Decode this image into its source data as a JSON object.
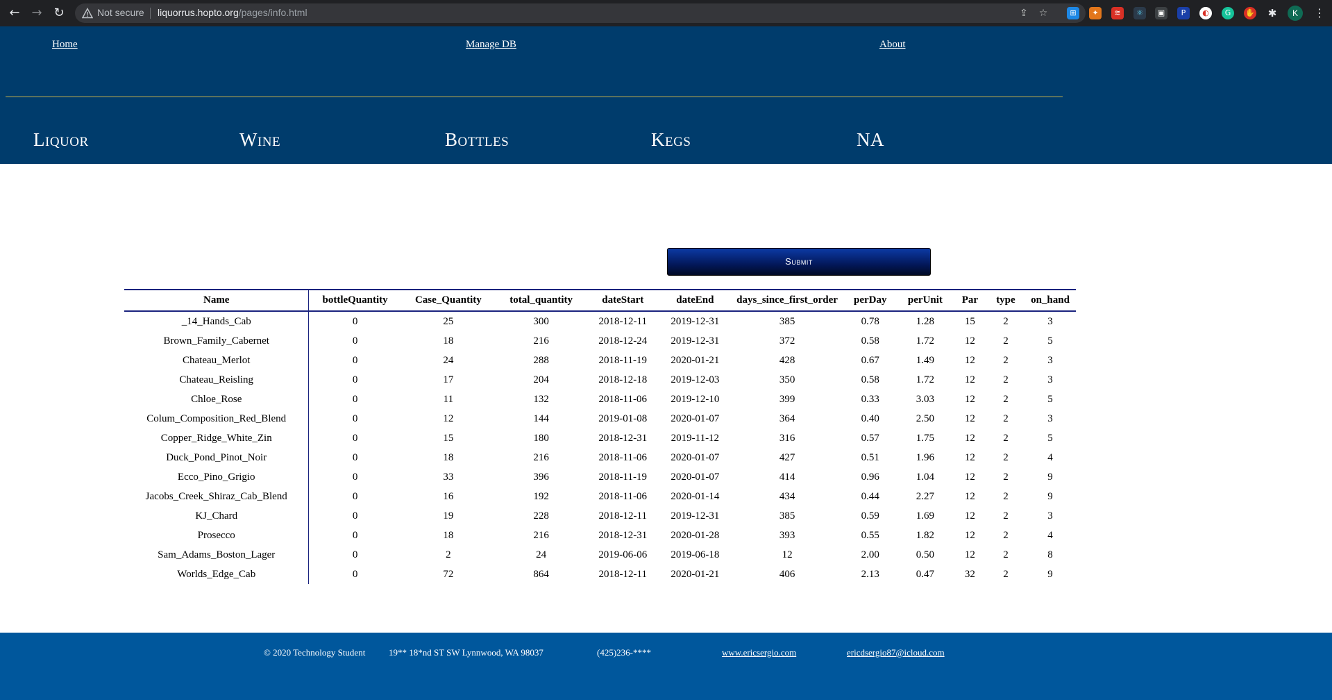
{
  "browser": {
    "not_secure": "Not secure",
    "url_host": "liquorrus.hopto.org",
    "url_path": "/pages/info.html",
    "profile_initial": "K"
  },
  "nav": {
    "home": "Home",
    "manage_db": "Manage DB",
    "about": "About"
  },
  "categories": [
    "Liquor",
    "Wine",
    "Bottles",
    "Kegs",
    "NA"
  ],
  "submit_label": "Submit",
  "table": {
    "headers": [
      "Name",
      "bottleQuantity",
      "Case_Quantity",
      "total_quantity",
      "dateStart",
      "dateEnd",
      "days_since_first_order",
      "perDay",
      "perUnit",
      "Par",
      "type",
      "on_hand"
    ],
    "rows": [
      [
        "_14_Hands_Cab",
        "0",
        "25",
        "300",
        "2018-12-11",
        "2019-12-31",
        "385",
        "0.78",
        "1.28",
        "15",
        "2",
        "3"
      ],
      [
        "Brown_Family_Cabernet",
        "0",
        "18",
        "216",
        "2018-12-24",
        "2019-12-31",
        "372",
        "0.58",
        "1.72",
        "12",
        "2",
        "5"
      ],
      [
        "Chateau_Merlot",
        "0",
        "24",
        "288",
        "2018-11-19",
        "2020-01-21",
        "428",
        "0.67",
        "1.49",
        "12",
        "2",
        "3"
      ],
      [
        "Chateau_Reisling",
        "0",
        "17",
        "204",
        "2018-12-18",
        "2019-12-03",
        "350",
        "0.58",
        "1.72",
        "12",
        "2",
        "3"
      ],
      [
        "Chloe_Rose",
        "0",
        "11",
        "132",
        "2018-11-06",
        "2019-12-10",
        "399",
        "0.33",
        "3.03",
        "12",
        "2",
        "5"
      ],
      [
        "Colum_Composition_Red_Blend",
        "0",
        "12",
        "144",
        "2019-01-08",
        "2020-01-07",
        "364",
        "0.40",
        "2.50",
        "12",
        "2",
        "3"
      ],
      [
        "Copper_Ridge_White_Zin",
        "0",
        "15",
        "180",
        "2018-12-31",
        "2019-11-12",
        "316",
        "0.57",
        "1.75",
        "12",
        "2",
        "5"
      ],
      [
        "Duck_Pond_Pinot_Noir",
        "0",
        "18",
        "216",
        "2018-11-06",
        "2020-01-07",
        "427",
        "0.51",
        "1.96",
        "12",
        "2",
        "4"
      ],
      [
        "Ecco_Pino_Grigio",
        "0",
        "33",
        "396",
        "2018-11-19",
        "2020-01-07",
        "414",
        "0.96",
        "1.04",
        "12",
        "2",
        "9"
      ],
      [
        "Jacobs_Creek_Shiraz_Cab_Blend",
        "0",
        "16",
        "192",
        "2018-11-06",
        "2020-01-14",
        "434",
        "0.44",
        "2.27",
        "12",
        "2",
        "9"
      ],
      [
        "KJ_Chard",
        "0",
        "19",
        "228",
        "2018-12-11",
        "2019-12-31",
        "385",
        "0.59",
        "1.69",
        "12",
        "2",
        "3"
      ],
      [
        "Prosecco",
        "0",
        "18",
        "216",
        "2018-12-31",
        "2020-01-28",
        "393",
        "0.55",
        "1.82",
        "12",
        "2",
        "4"
      ],
      [
        "Sam_Adams_Boston_Lager",
        "0",
        "2",
        "24",
        "2019-06-06",
        "2019-06-18",
        "12",
        "2.00",
        "0.50",
        "12",
        "2",
        "8"
      ],
      [
        "Worlds_Edge_Cab",
        "0",
        "72",
        "864",
        "2018-12-11",
        "2020-01-21",
        "406",
        "2.13",
        "0.47",
        "32",
        "2",
        "9"
      ]
    ]
  },
  "footer": {
    "copyright": "© 2020 Technology Student",
    "address": "19** 18*nd ST SW Lynnwood, WA 98037",
    "phone": "(425)236-****",
    "website": "www.ericsergio.com",
    "email": "ericdsergio87@icloud.com"
  }
}
